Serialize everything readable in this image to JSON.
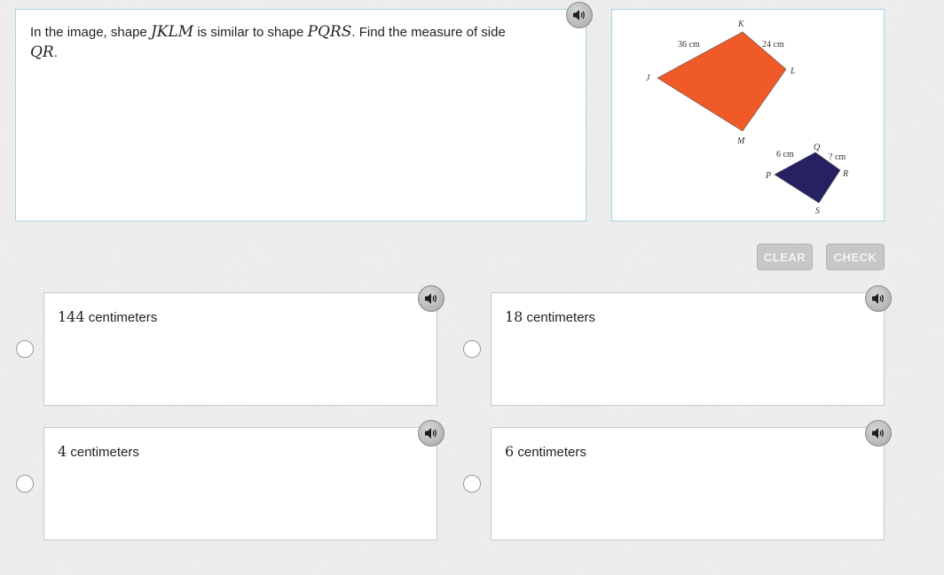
{
  "question": {
    "prefix": "In the image, shape ",
    "shape1": "JKLM",
    "middle": " is similar to shape ",
    "shape2": "PQRS",
    "suffix": ". Find the measure of side",
    "side": "QR",
    "end": "."
  },
  "figure": {
    "large_shape": {
      "color": "#f05a28",
      "vertices": [
        "J",
        "K",
        "L",
        "M"
      ],
      "side_labels": {
        "JK": "36 cm",
        "KL": "24 cm"
      }
    },
    "small_shape": {
      "color": "#262262",
      "vertices": [
        "P",
        "Q",
        "R",
        "S"
      ],
      "side_labels": {
        "PQ": "6 cm",
        "QR": "? cm"
      }
    }
  },
  "buttons": {
    "clear_label": "CLEAR",
    "check_label": "CHECK"
  },
  "choices": [
    {
      "number": "144",
      "unit": " centimeters"
    },
    {
      "number": "18",
      "unit": " centimeters"
    },
    {
      "number": "4",
      "unit": " centimeters"
    },
    {
      "number": "6",
      "unit": " centimeters"
    }
  ],
  "icons": {
    "audio": "speaker-icon"
  },
  "colors": {
    "panel_border": "#a6d3e3",
    "button_disabled": "#c7c7c7"
  }
}
